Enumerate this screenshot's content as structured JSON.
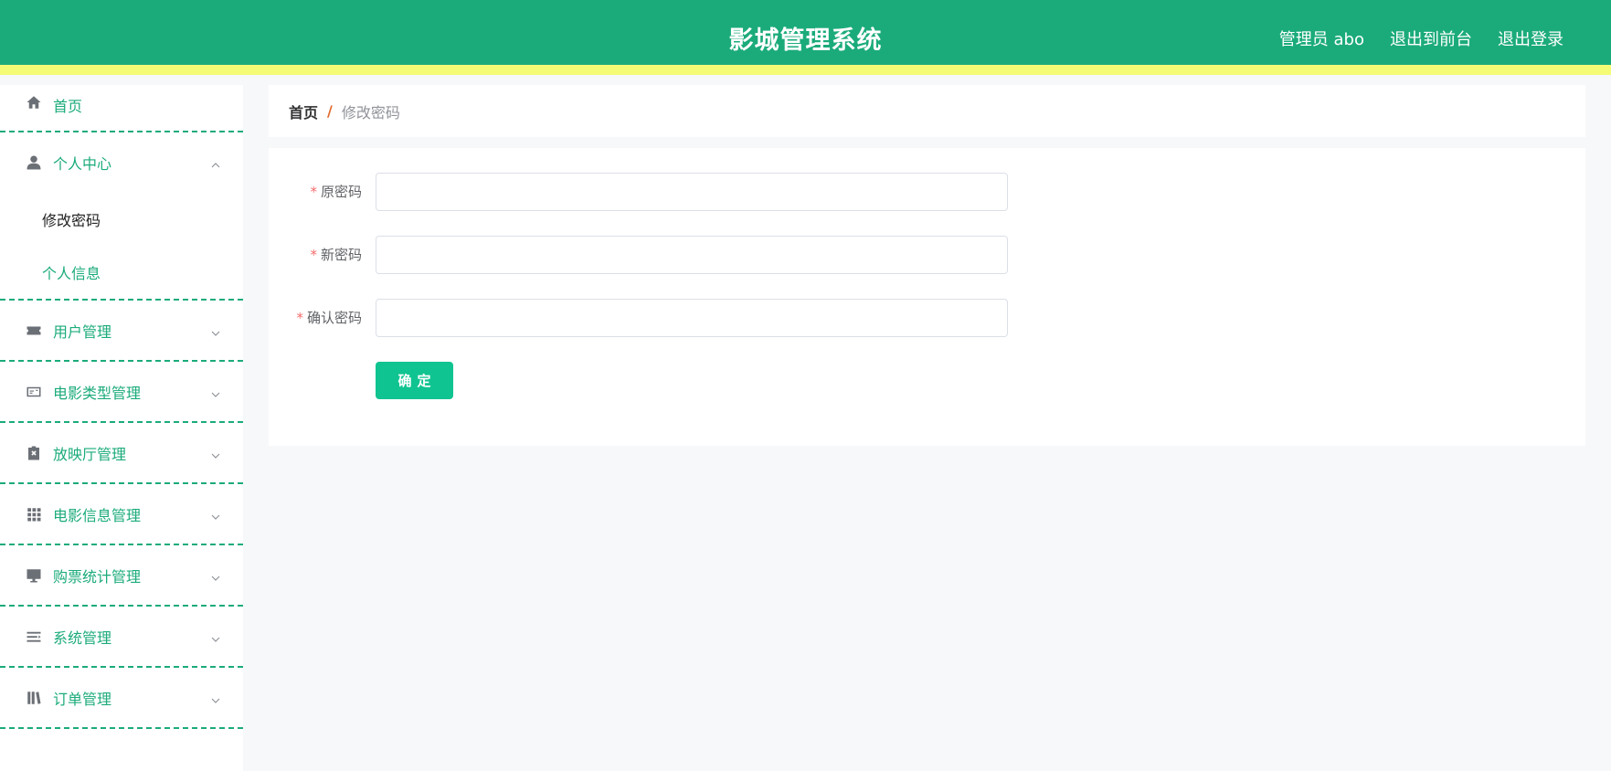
{
  "header": {
    "title": "影城管理系统",
    "user_label": "管理员 abo",
    "front_link": "退出到前台",
    "logout_link": "退出登录"
  },
  "sidebar": {
    "home": {
      "label": "首页",
      "icon": "home-icon"
    },
    "personal_center": {
      "label": "个人中心",
      "icon": "user-icon",
      "children": [
        {
          "label": "修改密码",
          "active": true
        },
        {
          "label": "个人信息",
          "active": false
        }
      ]
    },
    "items": [
      {
        "label": "用户管理",
        "icon": "ticket-icon"
      },
      {
        "label": "电影类型管理",
        "icon": "id-card-icon"
      },
      {
        "label": "放映厅管理",
        "icon": "clipboard-x-icon"
      },
      {
        "label": "电影信息管理",
        "icon": "grid-icon"
      },
      {
        "label": "购票统计管理",
        "icon": "monitor-icon"
      },
      {
        "label": "系统管理",
        "icon": "list-icon"
      },
      {
        "label": "订单管理",
        "icon": "book-icon"
      }
    ]
  },
  "breadcrumb": {
    "home": "首页",
    "separator": "/",
    "current": "修改密码"
  },
  "form": {
    "required_mark": "*",
    "old_password": {
      "label": "原密码",
      "value": "",
      "placeholder": ""
    },
    "new_password": {
      "label": "新密码",
      "value": "",
      "placeholder": ""
    },
    "confirm_password": {
      "label": "确认密码",
      "value": "",
      "placeholder": ""
    },
    "submit_label": "确定"
  },
  "colors": {
    "header_bg": "#1bab7a",
    "header_stripe": "#f4fb75",
    "accent": "#1bab7a",
    "button": "#10c491"
  }
}
